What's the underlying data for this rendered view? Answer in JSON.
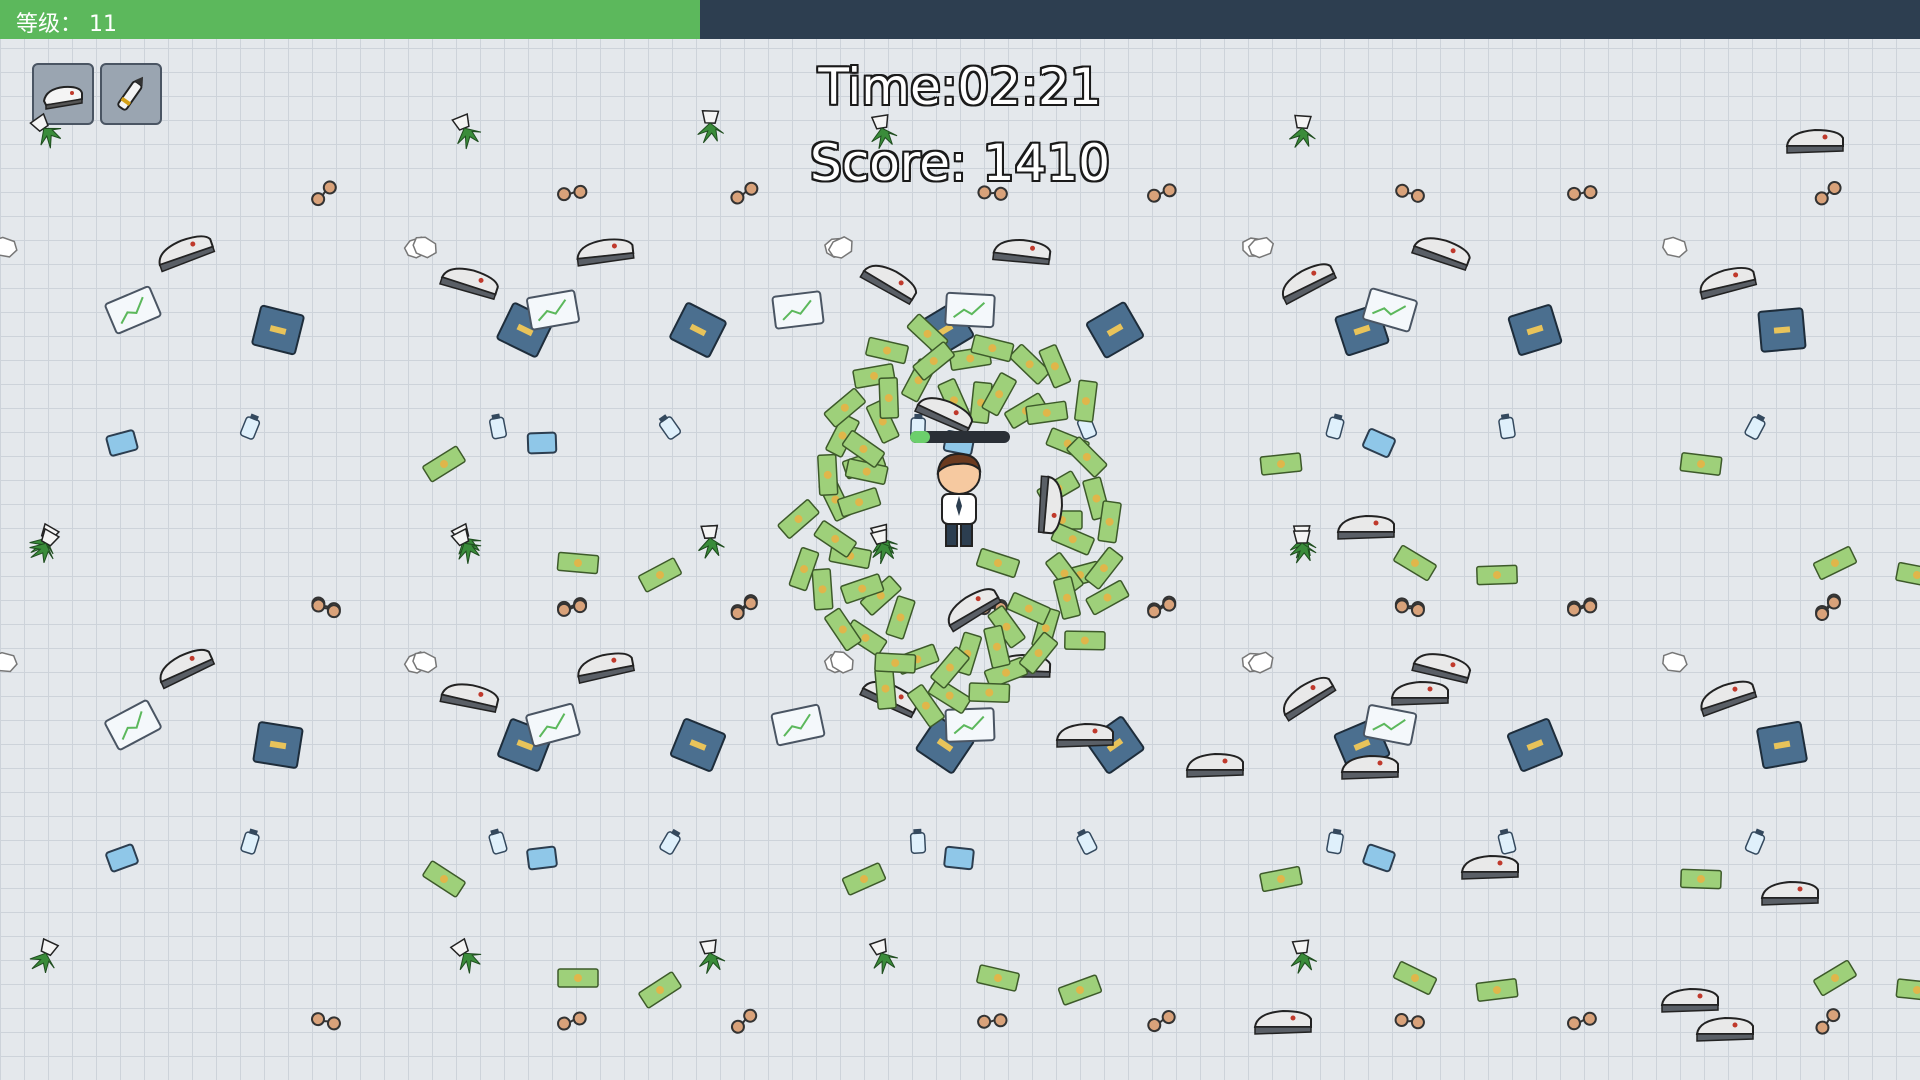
{
  "hud": {
    "level_label": "等级： 11",
    "level_progress": 0.3646,
    "time_text": "Time:02:21",
    "score_text": "Score: 1410"
  },
  "weapons": [
    {
      "icon": "stapler-icon"
    },
    {
      "icon": "pen-icon"
    }
  ],
  "player": {
    "health": 0.2
  },
  "colors": {
    "xp_fill": "#5cb85c",
    "xp_bg": "#2d3e50",
    "cash": "#9ed07a",
    "binder": "#4b6f8f",
    "stapler": "#5a5f66"
  }
}
